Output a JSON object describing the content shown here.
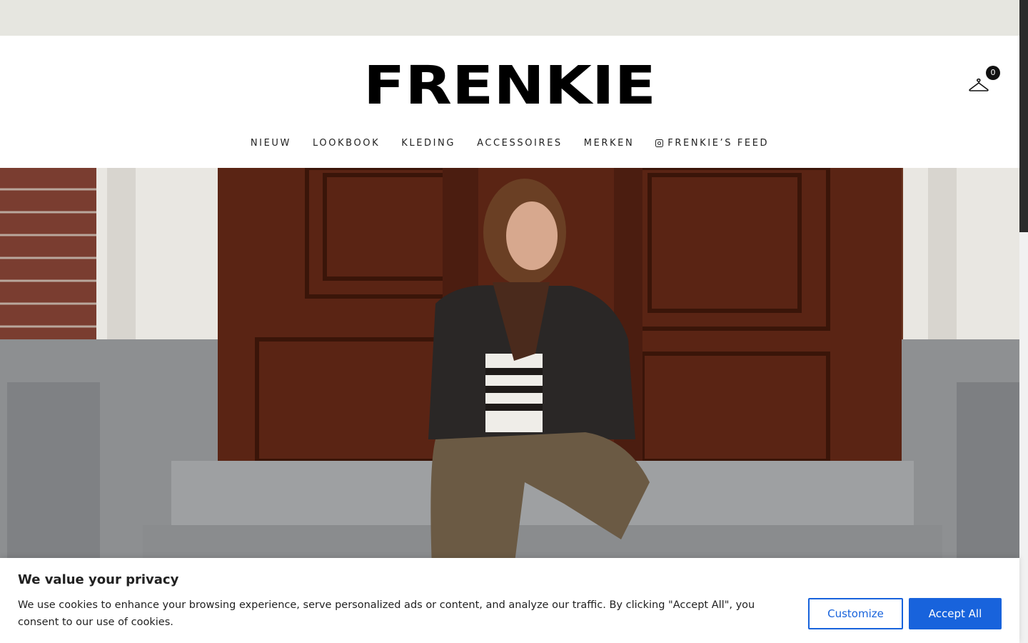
{
  "brand": {
    "logo_text": "FRENKIE"
  },
  "cart": {
    "count": "0"
  },
  "nav": {
    "items": [
      {
        "label": "NIEUW"
      },
      {
        "label": "LOOKBOOK"
      },
      {
        "label": "KLEDING"
      },
      {
        "label": "ACCESSOIRES"
      },
      {
        "label": "MERKEN"
      },
      {
        "label": "FRENKIE’S FEED",
        "icon": "instagram-icon"
      }
    ]
  },
  "cookie_banner": {
    "title": "We value your privacy",
    "text": "We use cookies to enhance your browsing experience, serve personalized ads or content, and analyze our traffic. By clicking \"Accept All\", you consent to our use of cookies.",
    "customize_label": "Customize",
    "accept_label": "Accept All"
  },
  "colors": {
    "topbar": "#e6e6e0",
    "accent": "#1863dc",
    "text": "#212121"
  }
}
